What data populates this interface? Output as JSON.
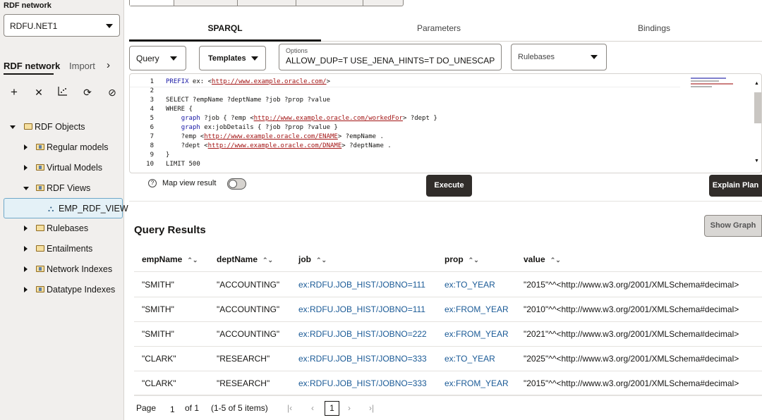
{
  "sidebar": {
    "network_label": "RDF network",
    "network_value": "RDFU.NET1",
    "tabs": [
      "RDF network",
      "Import"
    ],
    "toolbar_icons": [
      "add-icon",
      "close-icon",
      "chart-icon",
      "refresh-icon",
      "block-icon"
    ],
    "tree": {
      "root": "RDF Objects",
      "items": [
        "Regular models",
        "Virtual Models",
        "RDF Views",
        "EMP_RDF_VIEW",
        "Rulebases",
        "Entailments",
        "Network Indexes",
        "Datatype Indexes"
      ]
    }
  },
  "main": {
    "tabs": [
      "SPARQL",
      "Parameters",
      "Bindings"
    ],
    "query_select": "Query",
    "templates_label": "Templates",
    "options_label": "Options",
    "options_value": "ALLOW_DUP=T USE_JENA_HINTS=T DO_UNESCAPE=T",
    "rulebases_placeholder": "Rulebases",
    "editor_lines": [
      {
        "n": "1",
        "text": "PREFIX ex: <http://www.example.oracle.com/>"
      },
      {
        "n": "2",
        "text": ""
      },
      {
        "n": "3",
        "text": "SELECT ?empName ?deptName ?job ?prop ?value"
      },
      {
        "n": "4",
        "text": "WHERE {"
      },
      {
        "n": "5",
        "text": "    graph ?job { ?emp <http://www.example.oracle.com/workedFor> ?dept }"
      },
      {
        "n": "6",
        "text": "    graph ex:jobDetails { ?job ?prop ?value }"
      },
      {
        "n": "7",
        "text": "    ?emp <http://www.example.oracle.com/ENAME> ?empName ."
      },
      {
        "n": "8",
        "text": "    ?dept <http://www.example.oracle.com/DNAME> ?deptName ."
      },
      {
        "n": "9",
        "text": "}"
      },
      {
        "n": "10",
        "text": "LIMIT 500"
      }
    ],
    "map_view_label": "Map view result",
    "execute_label": "Execute",
    "explain_label": "Explain Plan",
    "results_title": "Query Results",
    "show_graph_label": "Show Graph",
    "columns": [
      "empName",
      "deptName",
      "job",
      "prop",
      "value"
    ],
    "rows": [
      [
        "\"SMITH\"",
        "\"ACCOUNTING\"",
        "ex:RDFU.JOB_HIST/JOBNO=111",
        "ex:TO_YEAR",
        "\"2015\"^^<http://www.w3.org/2001/XMLSchema#decimal>"
      ],
      [
        "\"SMITH\"",
        "\"ACCOUNTING\"",
        "ex:RDFU.JOB_HIST/JOBNO=111",
        "ex:FROM_YEAR",
        "\"2010\"^^<http://www.w3.org/2001/XMLSchema#decimal>"
      ],
      [
        "\"SMITH\"",
        "\"ACCOUNTING\"",
        "ex:RDFU.JOB_HIST/JOBNO=222",
        "ex:FROM_YEAR",
        "\"2021\"^^<http://www.w3.org/2001/XMLSchema#decimal>"
      ],
      [
        "\"CLARK\"",
        "\"RESEARCH\"",
        "ex:RDFU.JOB_HIST/JOBNO=333",
        "ex:TO_YEAR",
        "\"2025\"^^<http://www.w3.org/2001/XMLSchema#decimal>"
      ],
      [
        "\"CLARK\"",
        "\"RESEARCH\"",
        "ex:RDFU.JOB_HIST/JOBNO=333",
        "ex:FROM_YEAR",
        "\"2015\"^^<http://www.w3.org/2001/XMLSchema#decimal>"
      ]
    ],
    "pagination": {
      "page_label": "Page",
      "page_value": "1",
      "of_label": "of 1",
      "range_label": "(1-5 of 5 items)",
      "current": "1"
    }
  }
}
